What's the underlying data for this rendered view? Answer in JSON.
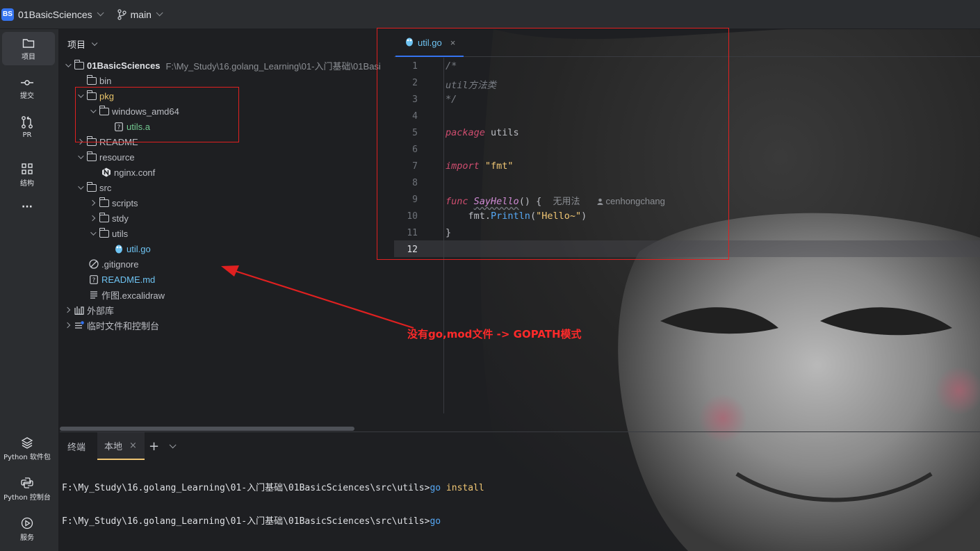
{
  "titlebar": {
    "project_badge": "BS",
    "project_name": "01BasicSciences",
    "branch": "main"
  },
  "toolstrip": {
    "items": [
      {
        "label": "项目",
        "icon": "folder-icon"
      },
      {
        "label": "提交",
        "icon": "commit-icon"
      },
      {
        "label": "PR",
        "icon": "pull-request-icon"
      },
      {
        "label": "结构",
        "icon": "structure-icon"
      },
      {
        "label": "···",
        "icon": "more-icon"
      }
    ],
    "bottom_items": [
      {
        "label": "Python 软件包",
        "icon": "layers-icon"
      },
      {
        "label": "Python 控制台",
        "icon": "python-console-icon"
      },
      {
        "label": "服务",
        "icon": "services-icon"
      }
    ]
  },
  "project_panel": {
    "header": "项目",
    "root_name": "01BasicSciences",
    "root_path": "F:\\My_Study\\16.golang_Learning\\01-入门基础\\01Basi",
    "tree": [
      {
        "label": "bin"
      },
      {
        "label": "pkg"
      },
      {
        "label": "windows_amd64"
      },
      {
        "label": "utils.a"
      },
      {
        "label": "README"
      },
      {
        "label": "resource"
      },
      {
        "label": "nginx.conf"
      },
      {
        "label": "src"
      },
      {
        "label": "scripts"
      },
      {
        "label": "stdy"
      },
      {
        "label": "utils"
      },
      {
        "label": "util.go"
      },
      {
        "label": ".gitignore"
      },
      {
        "label": "README.md"
      },
      {
        "label": "作图.excalidraw"
      },
      {
        "label": "外部库"
      },
      {
        "label": "临时文件和控制台"
      }
    ]
  },
  "editor": {
    "tab_name": "util.go",
    "tab_close": "×",
    "line_numbers": [
      "1",
      "2",
      "3",
      "4",
      "5",
      "6",
      "7",
      "8",
      "9",
      "10",
      "11",
      "12"
    ],
    "code": {
      "l1": "/*",
      "l2": "util方法类",
      "l3": "*/",
      "l5_kw": "package",
      "l5_name": " utils",
      "l7_kw": "import",
      "l7_str": "\"fmt\"",
      "l9_kw": "func",
      "l9_fn": "SayHello",
      "l9_rest": "() {",
      "l9_hint_usage": "无用法",
      "l9_hint_author": "cenhongchang",
      "l10_pkg": "    fmt.",
      "l10_method": "Println",
      "l10_open": "(",
      "l10_str": "\"Hello~\"",
      "l10_close": ")",
      "l11": "}"
    }
  },
  "terminal": {
    "tabs": [
      "终端",
      "本地"
    ],
    "tab_close": "×",
    "add": "+",
    "line1_prompt": "F:\\My_Study\\16.golang_Learning\\01-入门基础\\01BasicSciences\\src\\utils>",
    "line1_cmd": "go",
    "line1_arg": " install",
    "line2_prompt": "F:\\My_Study\\16.golang_Learning\\01-入门基础\\01BasicSciences\\src\\utils>",
    "line2_cmd": "go"
  },
  "annotation": {
    "text": "没有go,mod文件 -> GOPATH模式",
    "color": "#ff2a2a"
  },
  "colors": {
    "accent": "#3574f0",
    "keyword": "#cf4d6f",
    "string": "#f0c674",
    "file_go": "#6ec3f2",
    "file_new": "#73c991",
    "pkg_folder": "#e8c46a"
  }
}
